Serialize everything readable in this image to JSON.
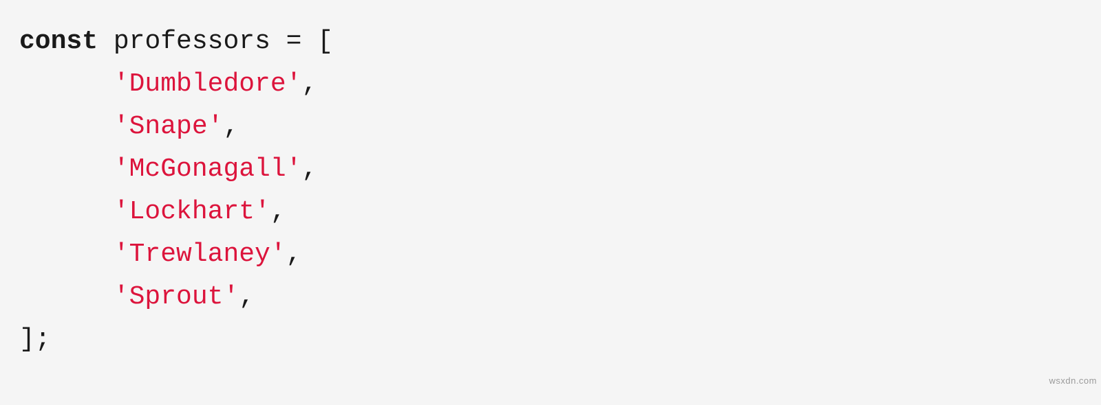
{
  "code": {
    "kw_const": "const",
    "decl_rest": " professors = [",
    "indent": "      ",
    "strings": [
      "'Dumbledore'",
      "'Snape'",
      "'McGonagall'",
      "'Lockhart'",
      "'Trewlaney'",
      "'Sprout'"
    ],
    "comma": ",",
    "close": "];"
  },
  "watermark": "wsxdn.com"
}
